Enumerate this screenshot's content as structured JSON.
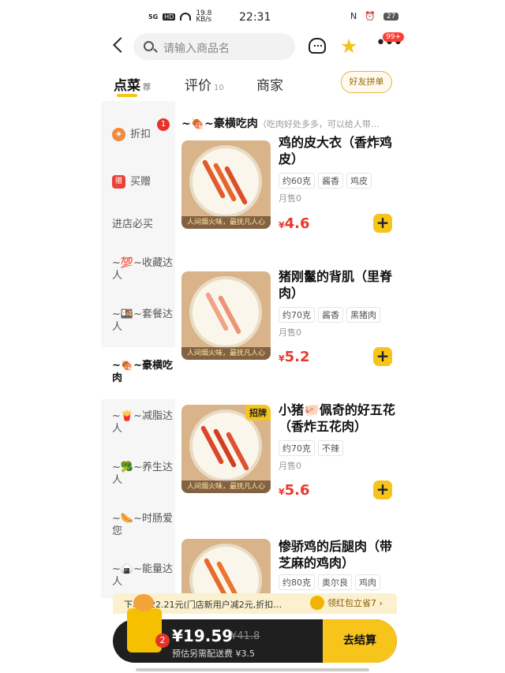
{
  "status": {
    "signal": "5G",
    "hd": "HD",
    "net_speed": "19.8\nKB/s",
    "time": "22:31",
    "nfc": "N",
    "battery": "27"
  },
  "search": {
    "placeholder": "请输入商品名"
  },
  "header": {
    "more_badge": "99+"
  },
  "tabs": [
    {
      "label": "点菜",
      "sub": "荐"
    },
    {
      "label": "评价",
      "sub": "10"
    },
    {
      "label": "商家",
      "sub": ""
    }
  ],
  "friend_button": "好友拼单",
  "sidebar": [
    {
      "label": "折扣",
      "badge": "1"
    },
    {
      "label": "买赠"
    },
    {
      "label": "进店必买"
    },
    {
      "label": "~💯~收藏达人"
    },
    {
      "label": "~🍱~套餐达人"
    },
    {
      "label": "~🍖~豪横吃肉"
    },
    {
      "label": "~🍟~减脂达人"
    },
    {
      "label": "~🥦~养生达人"
    },
    {
      "label": "~🌭~时肠爱您"
    },
    {
      "label": "~🍙~能量达人"
    }
  ],
  "category": {
    "title": "~🍖~豪横吃肉",
    "desc": "（吃肉好处多多，可以给人带…"
  },
  "products": [
    {
      "name": "鸡的皮大衣（香炸鸡皮）",
      "tags": [
        "约60克",
        "酱香",
        "鸡皮"
      ],
      "sold": "月售0",
      "price": "4.6",
      "currency": "¥",
      "photo_caption": "人间烟火味，最抚凡人心",
      "badge": ""
    },
    {
      "name": "猪刚鬣的背肌（里脊肉）",
      "tags": [
        "约70克",
        "酱香",
        "黑猪肉"
      ],
      "sold": "月售0",
      "price": "5.2",
      "currency": "¥",
      "photo_caption": "人间烟火味，最抚凡人心",
      "badge": ""
    },
    {
      "name": "小猪🐖佩奇的好五花（香炸五花肉）",
      "tags": [
        "约70克",
        "不辣"
      ],
      "sold": "月售0",
      "price": "5.6",
      "currency": "¥",
      "photo_caption": "人间烟火味，最抚凡人心",
      "badge": "招牌"
    },
    {
      "name": "惨骄鸡的后腿肉（带芝麻的鸡肉）",
      "tags": [
        "约80克",
        "奥尔良",
        "鸡肉"
      ],
      "sold": "",
      "price": "",
      "currency": "",
      "photo_caption": "",
      "badge": ""
    }
  ],
  "promo": {
    "text": "下单减22.21元(门店新用户减2元,折扣…",
    "action": "领红包立省7 ›"
  },
  "cart": {
    "count": "2",
    "amount": "¥19.59",
    "original": "¥41.8",
    "fee": "预估另需配送费 ¥3.5",
    "checkout": "去结算"
  },
  "colors": {
    "accent": "#f7c41c",
    "price": "#e63a2e"
  }
}
